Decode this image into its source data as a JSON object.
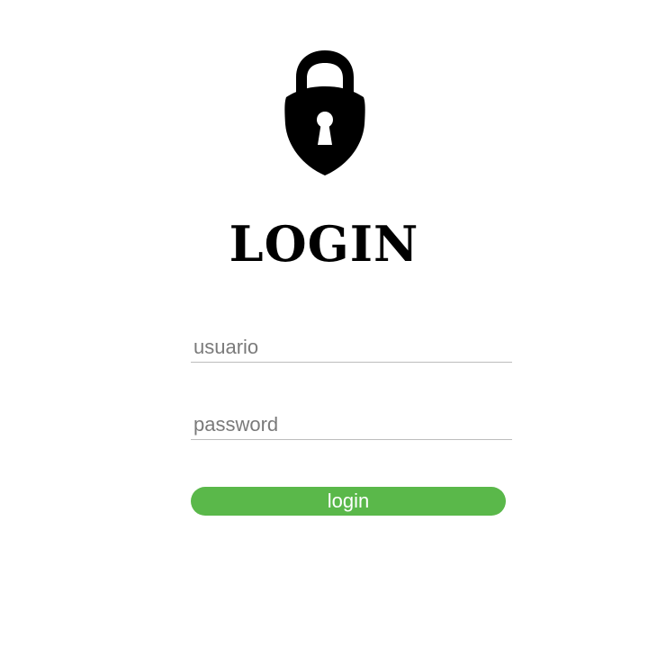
{
  "icon": "lock-icon",
  "title": "LOGIN",
  "username": {
    "value": "",
    "placeholder": "usuario"
  },
  "password": {
    "value": "",
    "placeholder": "password"
  },
  "login_button": {
    "label": "login",
    "color": "#5ab84a"
  }
}
